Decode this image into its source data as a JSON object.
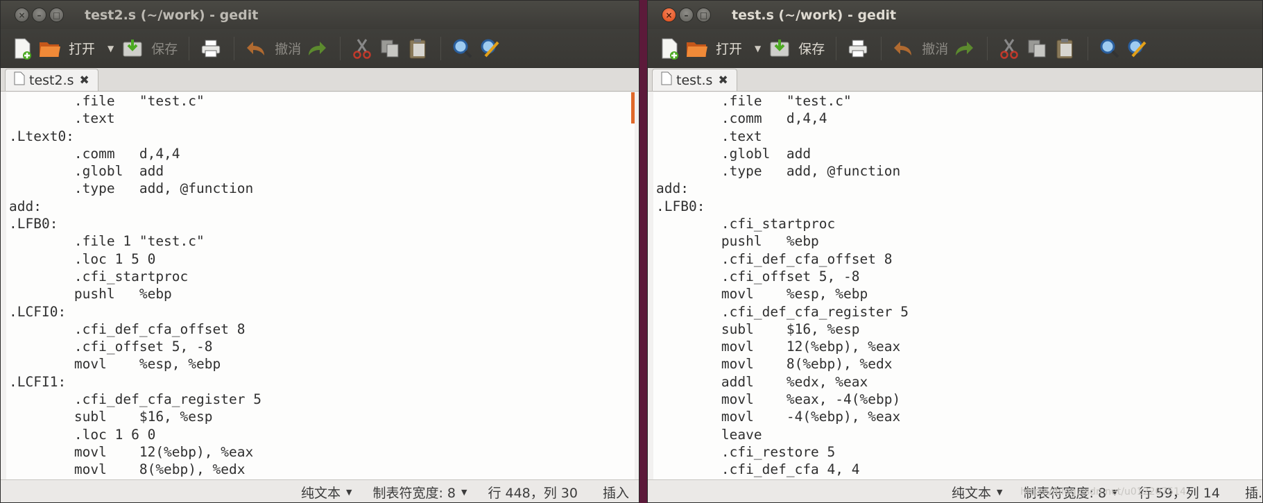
{
  "left": {
    "title": "test2.s (~/work) - gedit",
    "toolbar": {
      "open": "打开",
      "save": "保存",
      "undo": "撤消"
    },
    "tab": "test2.s",
    "lines": [
      "        .file   \"test.c\"",
      "        .text",
      ".Ltext0:",
      "        .comm   d,4,4",
      "        .globl  add",
      "        .type   add, @function",
      "add:",
      ".LFB0:",
      "        .file 1 \"test.c\"",
      "        .loc 1 5 0",
      "        .cfi_startproc",
      "        pushl   %ebp",
      ".LCFI0:",
      "        .cfi_def_cfa_offset 8",
      "        .cfi_offset 5, -8",
      "        movl    %esp, %ebp",
      ".LCFI1:",
      "        .cfi_def_cfa_register 5",
      "        subl    $16, %esp",
      "        .loc 1 6 0",
      "        movl    12(%ebp), %eax",
      "        movl    8(%ebp), %edx"
    ],
    "status": {
      "mode": "纯文本",
      "tabwidth": "制表符宽度: 8",
      "position": "行 448，列 30",
      "insert": "插入"
    }
  },
  "right": {
    "title": "test.s (~/work) - gedit",
    "toolbar": {
      "open": "打开",
      "save": "保存",
      "undo": "撤消"
    },
    "tab": "test.s",
    "lines": [
      "        .file   \"test.c\"",
      "        .comm   d,4,4",
      "        .text",
      "        .globl  add",
      "        .type   add, @function",
      "add:",
      ".LFB0:",
      "        .cfi_startproc",
      "        pushl   %ebp",
      "        .cfi_def_cfa_offset 8",
      "        .cfi_offset 5, -8",
      "        movl    %esp, %ebp",
      "        .cfi_def_cfa_register 5",
      "        subl    $16, %esp",
      "        movl    12(%ebp), %eax",
      "        movl    8(%ebp), %edx",
      "        addl    %edx, %eax",
      "        movl    %eax, -4(%ebp)",
      "        movl    -4(%ebp), %eax",
      "        leave",
      "        .cfi_restore 5",
      "        .cfi_def_cfa 4, 4"
    ],
    "status": {
      "mode": "纯文本",
      "tabwidth": "制表符宽度: 8",
      "position": "行 59，列 14",
      "insert": "插."
    },
    "watermark": "https://blog.csdn.net/u012207514"
  },
  "colors": {
    "accent": "#df4a16",
    "scroll_marker": "#e0692a",
    "titlebar": "#3c3b37"
  }
}
